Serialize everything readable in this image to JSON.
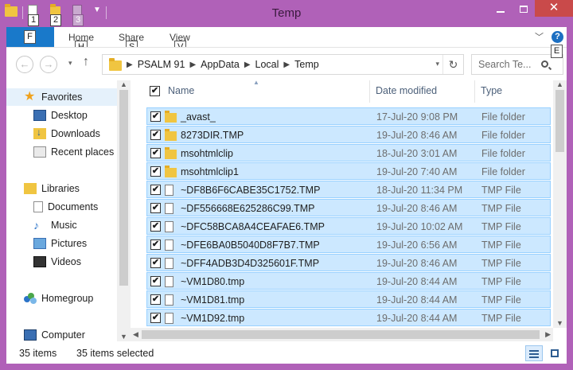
{
  "window": {
    "title": "Temp"
  },
  "qat": {
    "keytips": [
      "1",
      "2",
      "3"
    ]
  },
  "ribbon": {
    "file_keytip": "F",
    "tabs": [
      {
        "label": "Home",
        "keytip": "H"
      },
      {
        "label": "Share",
        "keytip": "S"
      },
      {
        "label": "View",
        "keytip": "V"
      }
    ],
    "help_keytip": "E"
  },
  "address": {
    "crumbs": [
      "PSALM 91",
      "AppData",
      "Local",
      "Temp"
    ],
    "search_placeholder": "Search Te..."
  },
  "navpane": {
    "favorites": "Favorites",
    "desktop": "Desktop",
    "downloads": "Downloads",
    "recent": "Recent places",
    "libraries": "Libraries",
    "documents": "Documents",
    "music": "Music",
    "pictures": "Pictures",
    "videos": "Videos",
    "homegroup": "Homegroup",
    "computer": "Computer"
  },
  "columns": {
    "name": "Name",
    "date": "Date modified",
    "type": "Type"
  },
  "files": [
    {
      "name": "_avast_",
      "date": "17-Jul-20 9:08 PM",
      "type": "File folder",
      "kind": "folder"
    },
    {
      "name": "8273DIR.TMP",
      "date": "19-Jul-20 8:46 AM",
      "type": "File folder",
      "kind": "folder"
    },
    {
      "name": "msohtmlclip",
      "date": "18-Jul-20 3:01 AM",
      "type": "File folder",
      "kind": "folder"
    },
    {
      "name": "msohtmlclip1",
      "date": "19-Jul-20 7:40 AM",
      "type": "File folder",
      "kind": "folder"
    },
    {
      "name": "~DF8B6F6CABE35C1752.TMP",
      "date": "18-Jul-20 11:34 PM",
      "type": "TMP File",
      "kind": "file"
    },
    {
      "name": "~DF556668E625286C99.TMP",
      "date": "19-Jul-20 8:46 AM",
      "type": "TMP File",
      "kind": "file"
    },
    {
      "name": "~DFC58BCA8A4CEAFAE6.TMP",
      "date": "19-Jul-20 10:02 AM",
      "type": "TMP File",
      "kind": "file"
    },
    {
      "name": "~DFE6BA0B5040D8F7B7.TMP",
      "date": "19-Jul-20 6:56 AM",
      "type": "TMP File",
      "kind": "file"
    },
    {
      "name": "~DFF4ADB3D4D325601F.TMP",
      "date": "19-Jul-20 8:46 AM",
      "type": "TMP File",
      "kind": "file"
    },
    {
      "name": "~VM1D80.tmp",
      "date": "19-Jul-20 8:44 AM",
      "type": "TMP File",
      "kind": "file"
    },
    {
      "name": "~VM1D81.tmp",
      "date": "19-Jul-20 8:44 AM",
      "type": "TMP File",
      "kind": "file"
    },
    {
      "name": "~VM1D92.tmp",
      "date": "19-Jul-20 8:44 AM",
      "type": "TMP File",
      "kind": "file"
    }
  ],
  "status": {
    "count": "35 items",
    "selected": "35 items selected"
  },
  "colors": {
    "accent": "#b061b8",
    "selection": "#cce8ff",
    "file_tab": "#1979ca",
    "close": "#c94a4a"
  }
}
